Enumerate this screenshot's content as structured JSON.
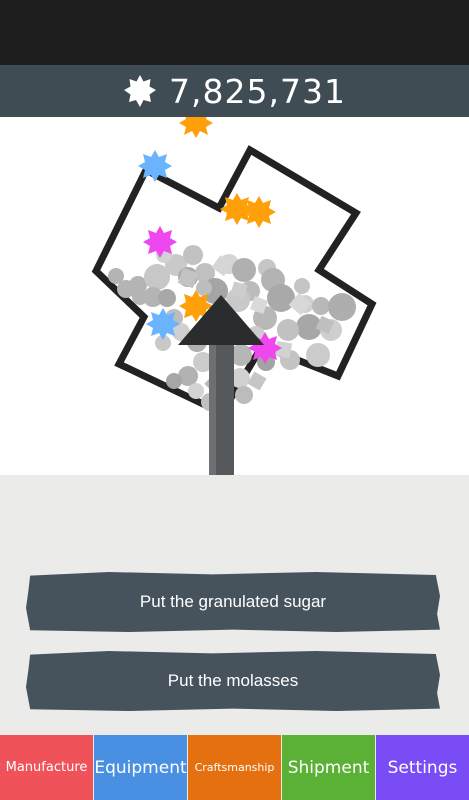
{
  "header": {
    "score": "7,825,731",
    "score_icon": "sugar-gear-icon"
  },
  "actions": [
    {
      "label": "Put the granulated sugar"
    },
    {
      "label": "Put the molasses"
    }
  ],
  "tabs": [
    {
      "label": "Manufacture",
      "color": "#f0525a"
    },
    {
      "label": "Equipment",
      "color": "#4a90e2"
    },
    {
      "label": "Craftsmanship",
      "color": "#e5700f"
    },
    {
      "label": "Shipment",
      "color": "#5bb036"
    },
    {
      "label": "Settings",
      "color": "#7a4cf5"
    }
  ],
  "colors": {
    "orange_candy": "#ff9f0a",
    "blue_candy": "#6ab3ff",
    "pink_candy": "#f046f0",
    "header_bg": "#3f4c53",
    "button_bg": "#47535c"
  }
}
